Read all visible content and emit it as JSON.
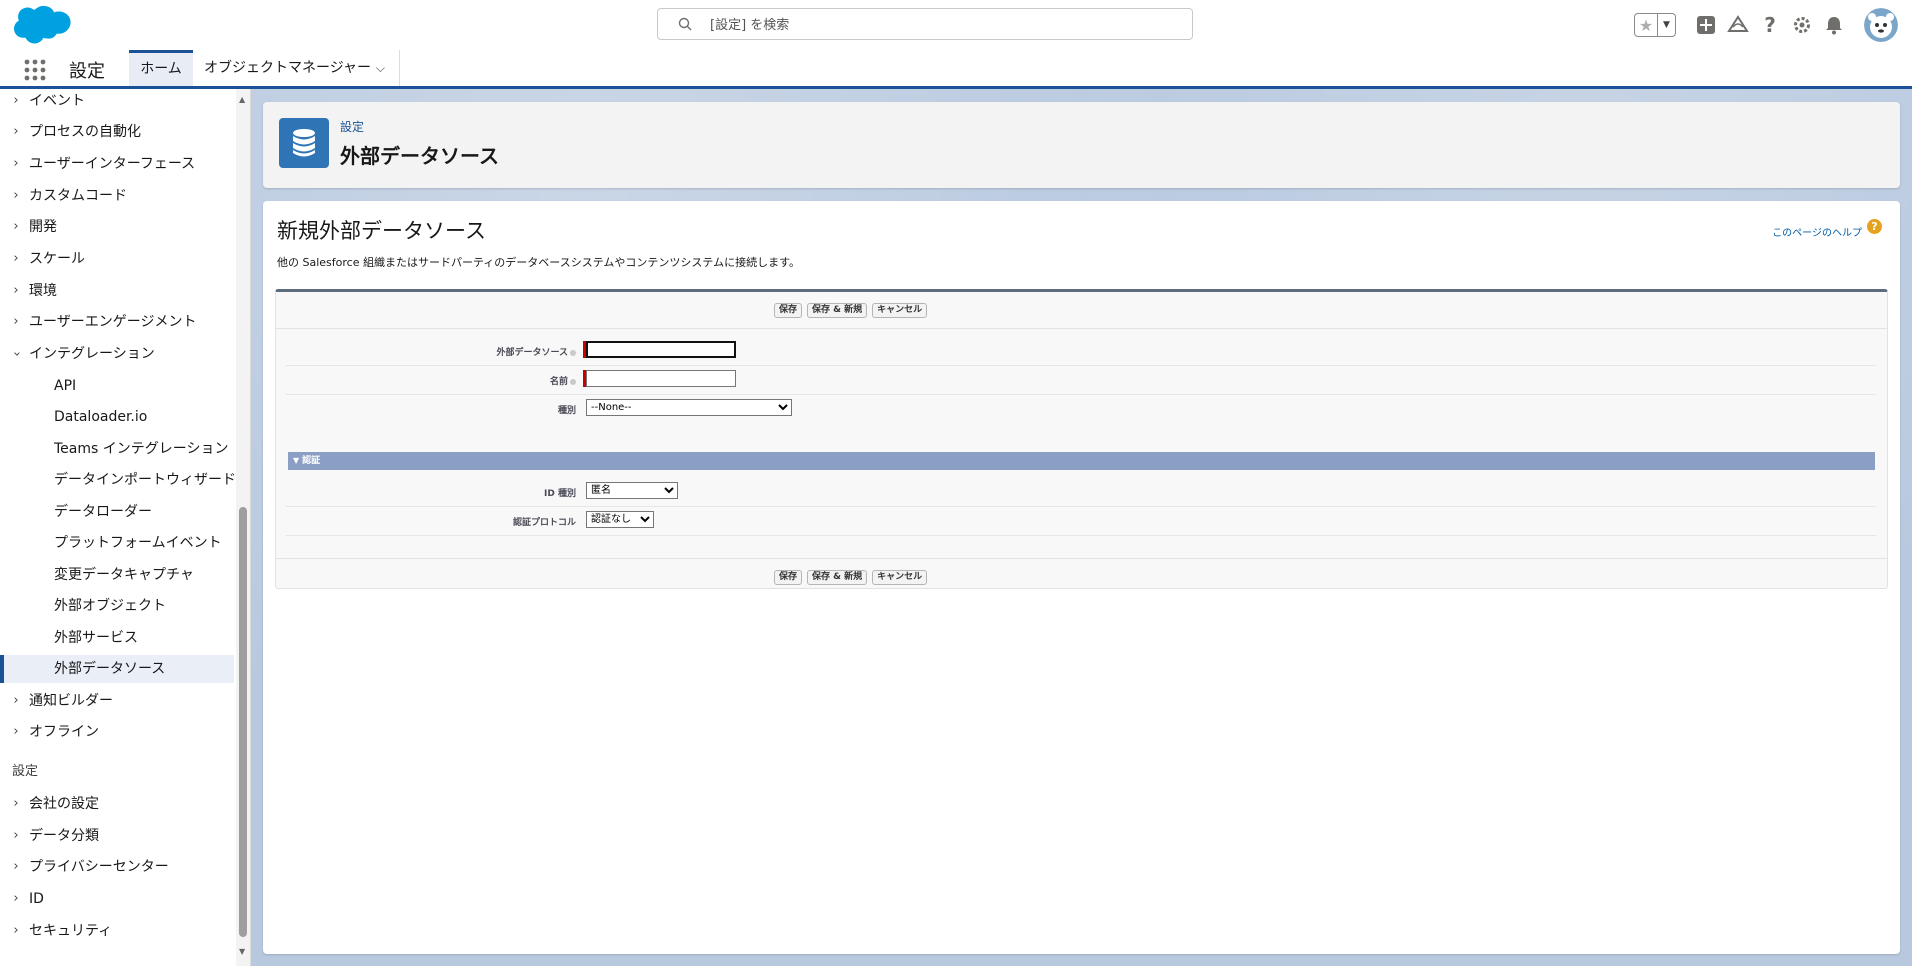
{
  "header": {
    "search_placeholder": "[設定] を検索"
  },
  "app_nav": {
    "app_name": "設定",
    "tabs": [
      {
        "label": "ホーム"
      },
      {
        "label": "オブジェクトマネージャー"
      }
    ]
  },
  "sidebar": {
    "items_top": [
      {
        "label": "イベント"
      },
      {
        "label": "プロセスの自動化"
      },
      {
        "label": "ユーザーインターフェース"
      },
      {
        "label": "カスタムコード"
      },
      {
        "label": "開発"
      },
      {
        "label": "スケール"
      },
      {
        "label": "環境"
      },
      {
        "label": "ユーザーエンゲージメント"
      },
      {
        "label": "インテグレーション"
      }
    ],
    "integration_children": [
      {
        "label": "API"
      },
      {
        "label": "Dataloader.io"
      },
      {
        "label": "Teams インテグレーション"
      },
      {
        "label": "データインポートウィザード"
      },
      {
        "label": "データローダー"
      },
      {
        "label": "プラットフォームイベント"
      },
      {
        "label": "変更データキャプチャ"
      },
      {
        "label": "外部オブジェクト"
      },
      {
        "label": "外部サービス"
      },
      {
        "label": "外部データソース"
      }
    ],
    "items_after": [
      {
        "label": "通知ビルダー"
      },
      {
        "label": "オフライン"
      }
    ],
    "section2_title": "設定",
    "section2_items": [
      {
        "label": "会社の設定"
      },
      {
        "label": "データ分類"
      },
      {
        "label": "プライバシーセンター"
      },
      {
        "label": "ID"
      },
      {
        "label": "セキュリティ"
      }
    ]
  },
  "page_header": {
    "breadcrumb": "設定",
    "title": "外部データソース"
  },
  "content": {
    "title": "新規外部データソース",
    "help_link": "このページのヘルプ",
    "description": "他の Salesforce 組織またはサードパーティのデータベースシステムやコンテンツシステムに接続します。",
    "buttons": {
      "save": "保存",
      "save_new": "保存 & 新規",
      "cancel": "キャンセル"
    },
    "fields": {
      "external_source_label": "外部データソース",
      "external_source_value": "",
      "name_label": "名前",
      "name_value": "",
      "type_label": "種別",
      "type_selected": "--None--"
    },
    "auth_section": {
      "title": "認証",
      "id_type_label": "ID 種別",
      "id_type_selected": "匿名",
      "protocol_label": "認証プロトコル",
      "protocol_selected": "認証なし"
    }
  },
  "colors": {
    "brand": "#1b5297",
    "section_bar": "#8b9ec4",
    "required": "#cc0000"
  }
}
